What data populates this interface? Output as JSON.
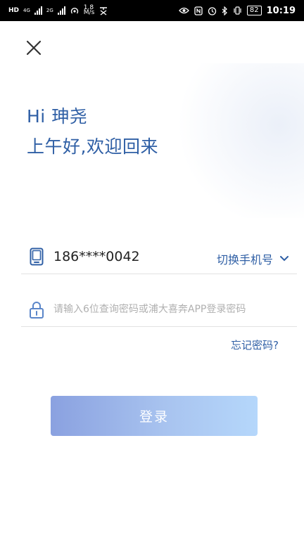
{
  "status_bar": {
    "left_labels": [
      "HD",
      "4G",
      "2G",
      "1.8",
      "M/s"
    ],
    "battery": "82",
    "time": "10:19"
  },
  "greeting": {
    "line1": "Hi 珅尧",
    "line2": "上午好,欢迎回来"
  },
  "phone": {
    "number": "186****0042",
    "switch_label": "切换手机号"
  },
  "password": {
    "placeholder": "请输入6位查询密码或浦大喜奔APP登录密码"
  },
  "forgot_label": "忘记密码?",
  "login_label": "登录",
  "colors": {
    "accent": "#2f5fa5",
    "button_start": "#8aa1e0",
    "button_end": "#b5d7fb"
  }
}
